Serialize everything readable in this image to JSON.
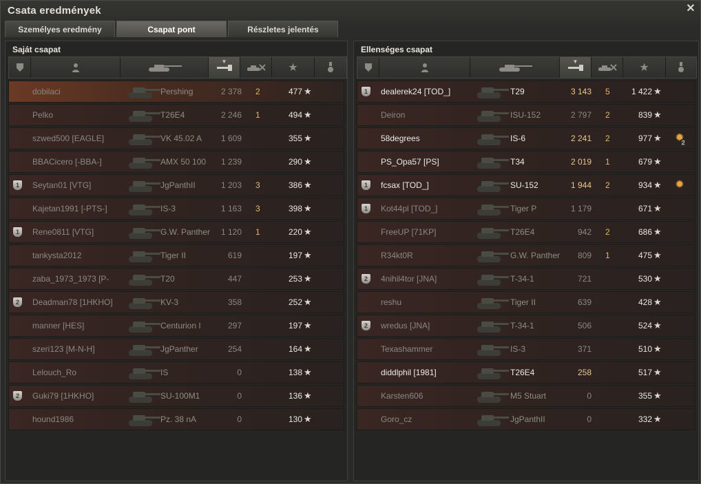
{
  "window": {
    "title": "Csata eredmények"
  },
  "tabs": [
    {
      "label": "Személyes eredmény"
    },
    {
      "label": "Csapat pont"
    },
    {
      "label": "Részletes jelentés"
    }
  ],
  "left": {
    "title": "Saját csapat",
    "rows": [
      {
        "name": "dobilaci",
        "tank": "Pershing",
        "dmg": "2 378",
        "kills": "2",
        "xp": "477",
        "me": true
      },
      {
        "name": "Pelko",
        "tank": "T26E4",
        "dmg": "2 246",
        "kills": "1",
        "xp": "494"
      },
      {
        "name": "szwed500 [EAGLE]",
        "tank": "VK 45.02 A",
        "dmg": "1 609",
        "kills": "",
        "xp": "355"
      },
      {
        "name": "BBACicero [-BBA-]",
        "tank": "AMX 50 100",
        "dmg": "1 239",
        "kills": "",
        "xp": "290"
      },
      {
        "name": "Seytan01 [VTG]",
        "tank": "JgPanthII",
        "dmg": "1 203",
        "kills": "3",
        "xp": "386",
        "squad": "1"
      },
      {
        "name": "Kajetan1991 [-PTS-]",
        "tank": "IS-3",
        "dmg": "1 163",
        "kills": "3",
        "xp": "398"
      },
      {
        "name": "Rene0811 [VTG]",
        "tank": "G.W. Panther",
        "dmg": "1 120",
        "kills": "1",
        "xp": "220",
        "squad": "1"
      },
      {
        "name": "tankysta2012",
        "tank": "Tiger II",
        "dmg": "619",
        "kills": "",
        "xp": "197"
      },
      {
        "name": "zaba_1973_1973 [P-",
        "tank": "T20",
        "dmg": "447",
        "kills": "",
        "xp": "253"
      },
      {
        "name": "Deadman78 [1HKHO]",
        "tank": "KV-3",
        "dmg": "358",
        "kills": "",
        "xp": "252",
        "squad": "2"
      },
      {
        "name": "manner [HES]",
        "tank": "Centurion I",
        "dmg": "297",
        "kills": "",
        "xp": "197"
      },
      {
        "name": "szeri123 [M-N-H]",
        "tank": "JgPanther",
        "dmg": "254",
        "kills": "",
        "xp": "164"
      },
      {
        "name": "Lelouch_Ro",
        "tank": "IS",
        "dmg": "0",
        "kills": "",
        "xp": "138"
      },
      {
        "name": "Guki79 [1HKHO]",
        "tank": "SU-100M1",
        "dmg": "0",
        "kills": "",
        "xp": "136",
        "squad": "2"
      },
      {
        "name": "hound1986",
        "tank": "Pz. 38 nA",
        "dmg": "0",
        "kills": "",
        "xp": "130"
      }
    ]
  },
  "right": {
    "title": "Ellenséges csapat",
    "rows": [
      {
        "name": "dealerek24 [TOD_]",
        "tank": "T29",
        "dmg": "3 143",
        "kills": "5",
        "xp": "1 422",
        "squad": "1",
        "alive": true
      },
      {
        "name": "Deiron",
        "tank": "ISU-152",
        "dmg": "2 797",
        "kills": "2",
        "xp": "839"
      },
      {
        "name": "58degrees",
        "tank": "IS-6",
        "dmg": "2 241",
        "kills": "2",
        "xp": "977",
        "alive": true,
        "medal": "2"
      },
      {
        "name": "PS_Opa57 [PS]",
        "tank": "T34",
        "dmg": "2 019",
        "kills": "1",
        "xp": "679",
        "alive": true
      },
      {
        "name": "fcsax [TOD_]",
        "tank": "SU-152",
        "dmg": "1 944",
        "kills": "2",
        "xp": "934",
        "squad": "1",
        "alive": true,
        "medal": ""
      },
      {
        "name": "Kot44pl [TOD_]",
        "tank": "Tiger P",
        "dmg": "1 179",
        "kills": "",
        "xp": "671",
        "squad": "1"
      },
      {
        "name": "FreeUP [71KP]",
        "tank": "T26E4",
        "dmg": "942",
        "kills": "2",
        "xp": "686"
      },
      {
        "name": "R34kt0R",
        "tank": "G.W. Panther",
        "dmg": "809",
        "kills": "1",
        "xp": "475"
      },
      {
        "name": "4nihil4tor [JNA]",
        "tank": "T-34-1",
        "dmg": "721",
        "kills": "",
        "xp": "530",
        "squad": "2"
      },
      {
        "name": "reshu",
        "tank": "Tiger II",
        "dmg": "639",
        "kills": "",
        "xp": "428"
      },
      {
        "name": "wredus [JNA]",
        "tank": "T-34-1",
        "dmg": "506",
        "kills": "",
        "xp": "524",
        "squad": "2"
      },
      {
        "name": "Texashammer",
        "tank": "IS-3",
        "dmg": "371",
        "kills": "",
        "xp": "510"
      },
      {
        "name": "diddlphil [1981]",
        "tank": "T26E4",
        "dmg": "258",
        "kills": "",
        "xp": "517",
        "alive": true
      },
      {
        "name": "Karsten606",
        "tank": "M5 Stuart",
        "dmg": "0",
        "kills": "",
        "xp": "355"
      },
      {
        "name": "Goro_cz",
        "tank": "JgPanthII",
        "dmg": "0",
        "kills": "",
        "xp": "332"
      }
    ]
  },
  "icons": {
    "close": "close-icon",
    "squad": "squad-shield-icon",
    "player": "player-icon",
    "tank": "tank-icon",
    "damage": "damage-icon",
    "kills": "kills-icon",
    "xp": "star-icon",
    "medal": "medal-icon"
  }
}
